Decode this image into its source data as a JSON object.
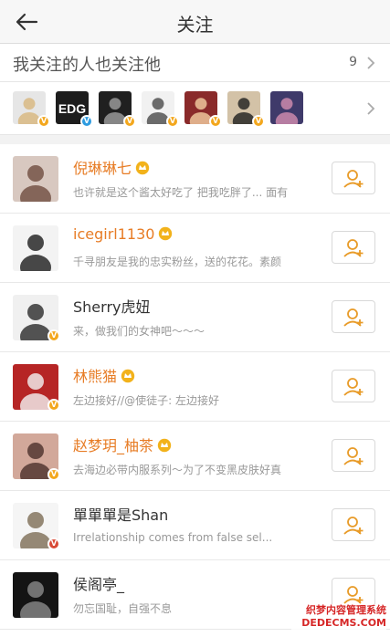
{
  "header": {
    "title": "关注",
    "back_icon": "back-arrow-icon"
  },
  "mutual": {
    "title": "我关注的人也关注他",
    "count": "9",
    "avatars": [
      {
        "bg": "#e6e6e6",
        "fg": "#d8b67d",
        "badge": "orange"
      },
      {
        "bg": "#1d1d1d",
        "fg": "#ffffff",
        "badge": "blue",
        "label": "EDG"
      },
      {
        "bg": "#202020",
        "fg": "#a0a0a0",
        "badge": "orange"
      },
      {
        "bg": "#f1f1f1",
        "fg": "#4a4a4a",
        "badge": "orange"
      },
      {
        "bg": "#8a2a2a",
        "fg": "#f4d0a2",
        "badge": "orange"
      },
      {
        "bg": "#d3c2a7",
        "fg": "#1e1e1e",
        "badge": "orange"
      },
      {
        "bg": "#3f3a6a",
        "fg": "#d58fb0",
        "badge": "none"
      }
    ]
  },
  "items": [
    {
      "name": "倪琳琳七",
      "vip": true,
      "desc": "也许就是这个酱太好吃了 把我吃胖了... 面有",
      "avatar_bg": "#d8c8c0",
      "avatar_fg": "#6f4c3e",
      "badge": "none"
    },
    {
      "name": "icegirl1130",
      "vip": true,
      "desc": "千寻朋友是我的忠实粉丝，送的花花。素颜",
      "avatar_bg": "#f3f3f3",
      "avatar_fg": "#1b1b1b",
      "badge": "none"
    },
    {
      "name": "Sherry虎妞",
      "vip": false,
      "desc": "来，做我们的女神吧〜〜〜",
      "avatar_bg": "#f0f0f0",
      "avatar_fg": "#2a2a2a",
      "badge": "orange"
    },
    {
      "name": "林熊猫",
      "vip": true,
      "desc": "左边接好//@使徒子: 左边接好",
      "avatar_bg": "#b62525",
      "avatar_fg": "#f4f4f4",
      "badge": "orange"
    },
    {
      "name": "赵梦玥_柚茶",
      "vip": true,
      "desc": "去海边必带内服系列〜为了不变黑皮肤好真",
      "avatar_bg": "#d2a89a",
      "avatar_fg": "#4b2f2a",
      "badge": "orange"
    },
    {
      "name": "單單單是Shan",
      "vip": false,
      "desc": "Irrelationship comes from false sel...",
      "avatar_bg": "#f5f5f5",
      "avatar_fg": "#7d6d55",
      "badge": "red"
    },
    {
      "name": "侯阁亭_",
      "vip": false,
      "desc": "勿忘国耻，自强不息",
      "avatar_bg": "#141414",
      "avatar_fg": "#8a8a8a",
      "badge": "none"
    }
  ],
  "watermark": {
    "line1": "织梦内容管理系统",
    "line2": "DEDECMS.COM"
  },
  "colors": {
    "accent": "#e77c25",
    "badge_orange": "#f3a71d",
    "badge_blue": "#2d9be0",
    "badge_red": "#d84a36"
  }
}
